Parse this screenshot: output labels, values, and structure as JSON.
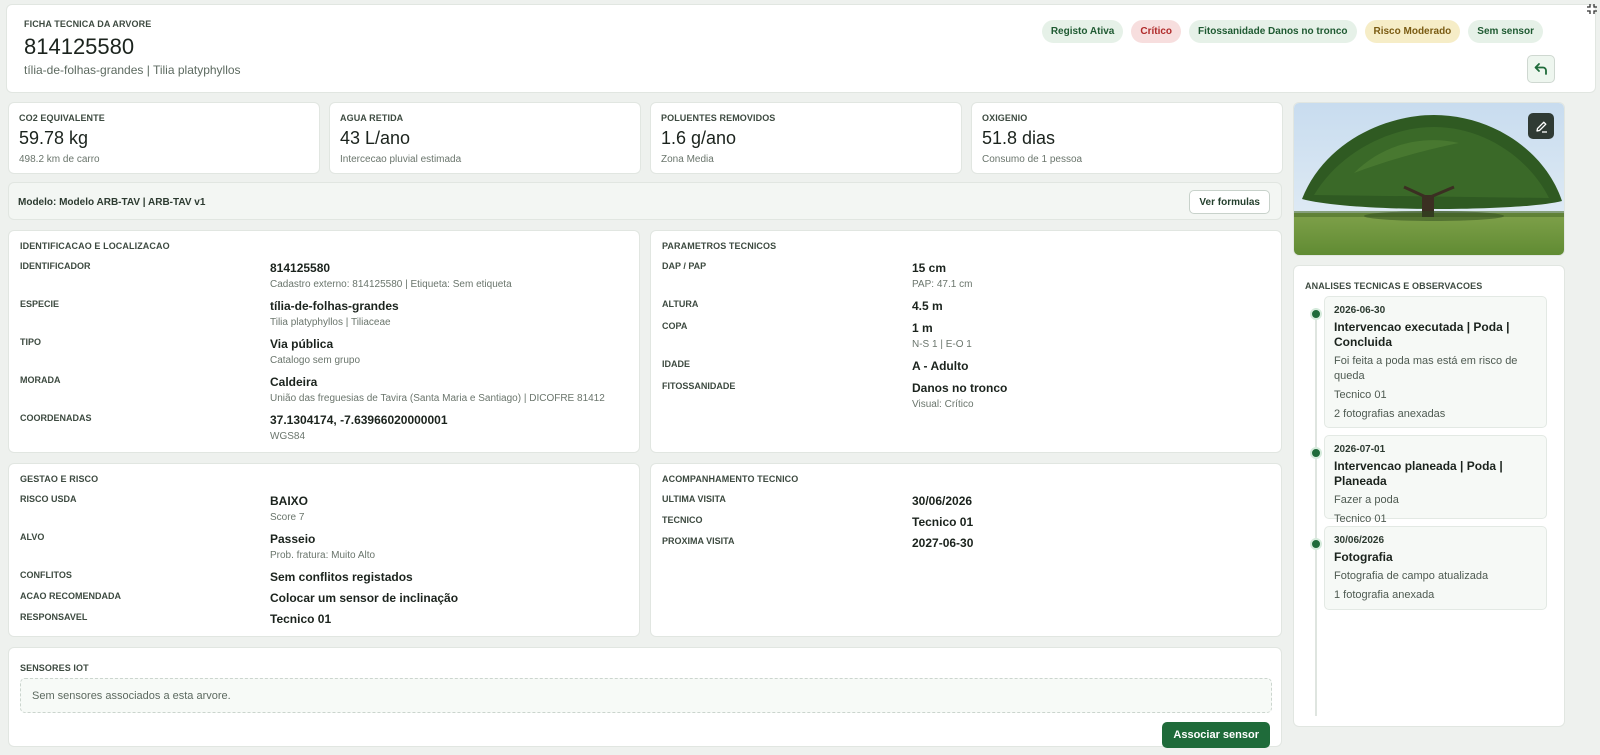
{
  "header": {
    "overline": "FICHA TECNICA DA ARVORE",
    "id": "814125580",
    "subtitle": "tília-de-folhas-grandes | Tilia platyphyllos",
    "badges": [
      "Registo Ativa",
      "Crítico",
      "Fitossanidade Danos no tronco",
      "Risco Moderado",
      "Sem sensor"
    ]
  },
  "metrics": [
    {
      "label": "CO2 EQUIVALENTE",
      "value": "59.78 kg",
      "note": "498.2 km de carro"
    },
    {
      "label": "AGUA RETIDA",
      "value": "43 L/ano",
      "note": "Intercecao pluvial estimada"
    },
    {
      "label": "POLUENTES REMOVIDOS",
      "value": "1.6 g/ano",
      "note": "Zona Media"
    },
    {
      "label": "OXIGENIO",
      "value": "51.8 dias",
      "note": "Consumo de 1 pessoa"
    }
  ],
  "model": {
    "text": "Modelo: Modelo ARB-TAV | ARB-TAV v1",
    "button": "Ver formulas"
  },
  "identificacao": {
    "title": "IDENTIFICACAO E LOCALIZACAO",
    "rows": [
      {
        "k": "IDENTIFICADOR",
        "v": "814125580",
        "s": "Cadastro externo: 814125580 | Etiqueta: Sem etiqueta"
      },
      {
        "k": "ESPECIE",
        "v": "tília-de-folhas-grandes",
        "s": "Tilia platyphyllos | Tiliaceae"
      },
      {
        "k": "TIPO",
        "v": "Via pública",
        "s": "Catalogo sem grupo"
      },
      {
        "k": "MORADA",
        "v": "Caldeira",
        "s": "União das freguesias de Tavira (Santa Maria e Santiago) | DICOFRE 81412"
      },
      {
        "k": "COORDENADAS",
        "v": "37.1304174, -7.63966020000001",
        "s": "WGS84"
      }
    ]
  },
  "parametros": {
    "title": "PARAMETROS TECNICOS",
    "rows": [
      {
        "k": "DAP / PAP",
        "v": "15 cm",
        "s": "PAP: 47.1 cm"
      },
      {
        "k": "ALTURA",
        "v": "4.5 m",
        "s": ""
      },
      {
        "k": "COPA",
        "v": "1 m",
        "s": "N-S 1 | E-O 1"
      },
      {
        "k": "IDADE",
        "v": "A - Adulto",
        "s": ""
      },
      {
        "k": "FITOSSANIDADE",
        "v": "Danos no tronco",
        "s": "Visual: Crítico"
      }
    ]
  },
  "gestao": {
    "title": "GESTAO E RISCO",
    "rows": [
      {
        "k": "RISCO USDA",
        "v": "BAIXO",
        "s": "Score 7"
      },
      {
        "k": "ALVO",
        "v": "Passeio",
        "s": "Prob. fratura: Muito Alto"
      },
      {
        "k": "CONFLITOS",
        "v": "Sem conflitos registados",
        "s": ""
      },
      {
        "k": "ACAO RECOMENDADA",
        "v": "Colocar um sensor de inclinação",
        "s": ""
      },
      {
        "k": "RESPONSAVEL",
        "v": "Tecnico 01",
        "s": ""
      }
    ]
  },
  "acompanhamento": {
    "title": "ACOMPANHAMENTO TECNICO",
    "rows": [
      {
        "k": "ULTIMA VISITA",
        "v": "30/06/2026",
        "s": ""
      },
      {
        "k": "TECNICO",
        "v": "Tecnico 01",
        "s": ""
      },
      {
        "k": "PROXIMA VISITA",
        "v": "2027-06-30",
        "s": ""
      }
    ]
  },
  "observacoes": {
    "title": "ANALISES TECNICAS E OBSERVACOES",
    "items": [
      {
        "date": "2026-06-30",
        "title": "Intervencao executada | Poda | Concluida",
        "lines": [
          "Foi feita a poda mas está em risco de queda",
          "Tecnico 01",
          "2 fotografias anexadas"
        ]
      },
      {
        "date": "2026-07-01",
        "title": "Intervencao planeada | Poda | Planeada",
        "lines": [
          "Fazer a poda",
          "Tecnico 01"
        ]
      },
      {
        "date": "30/06/2026",
        "title": "Fotografia",
        "lines": [
          "Fotografia de campo atualizada",
          "1 fotografia anexada"
        ]
      }
    ]
  },
  "sensores": {
    "title": "SENSORES IOT",
    "empty": "Sem sensores associados a esta arvore.",
    "button": "Associar sensor"
  },
  "colors": {
    "primary": "#1f6b3a",
    "critical": "#b02a2a",
    "warning": "#7a5b12"
  }
}
